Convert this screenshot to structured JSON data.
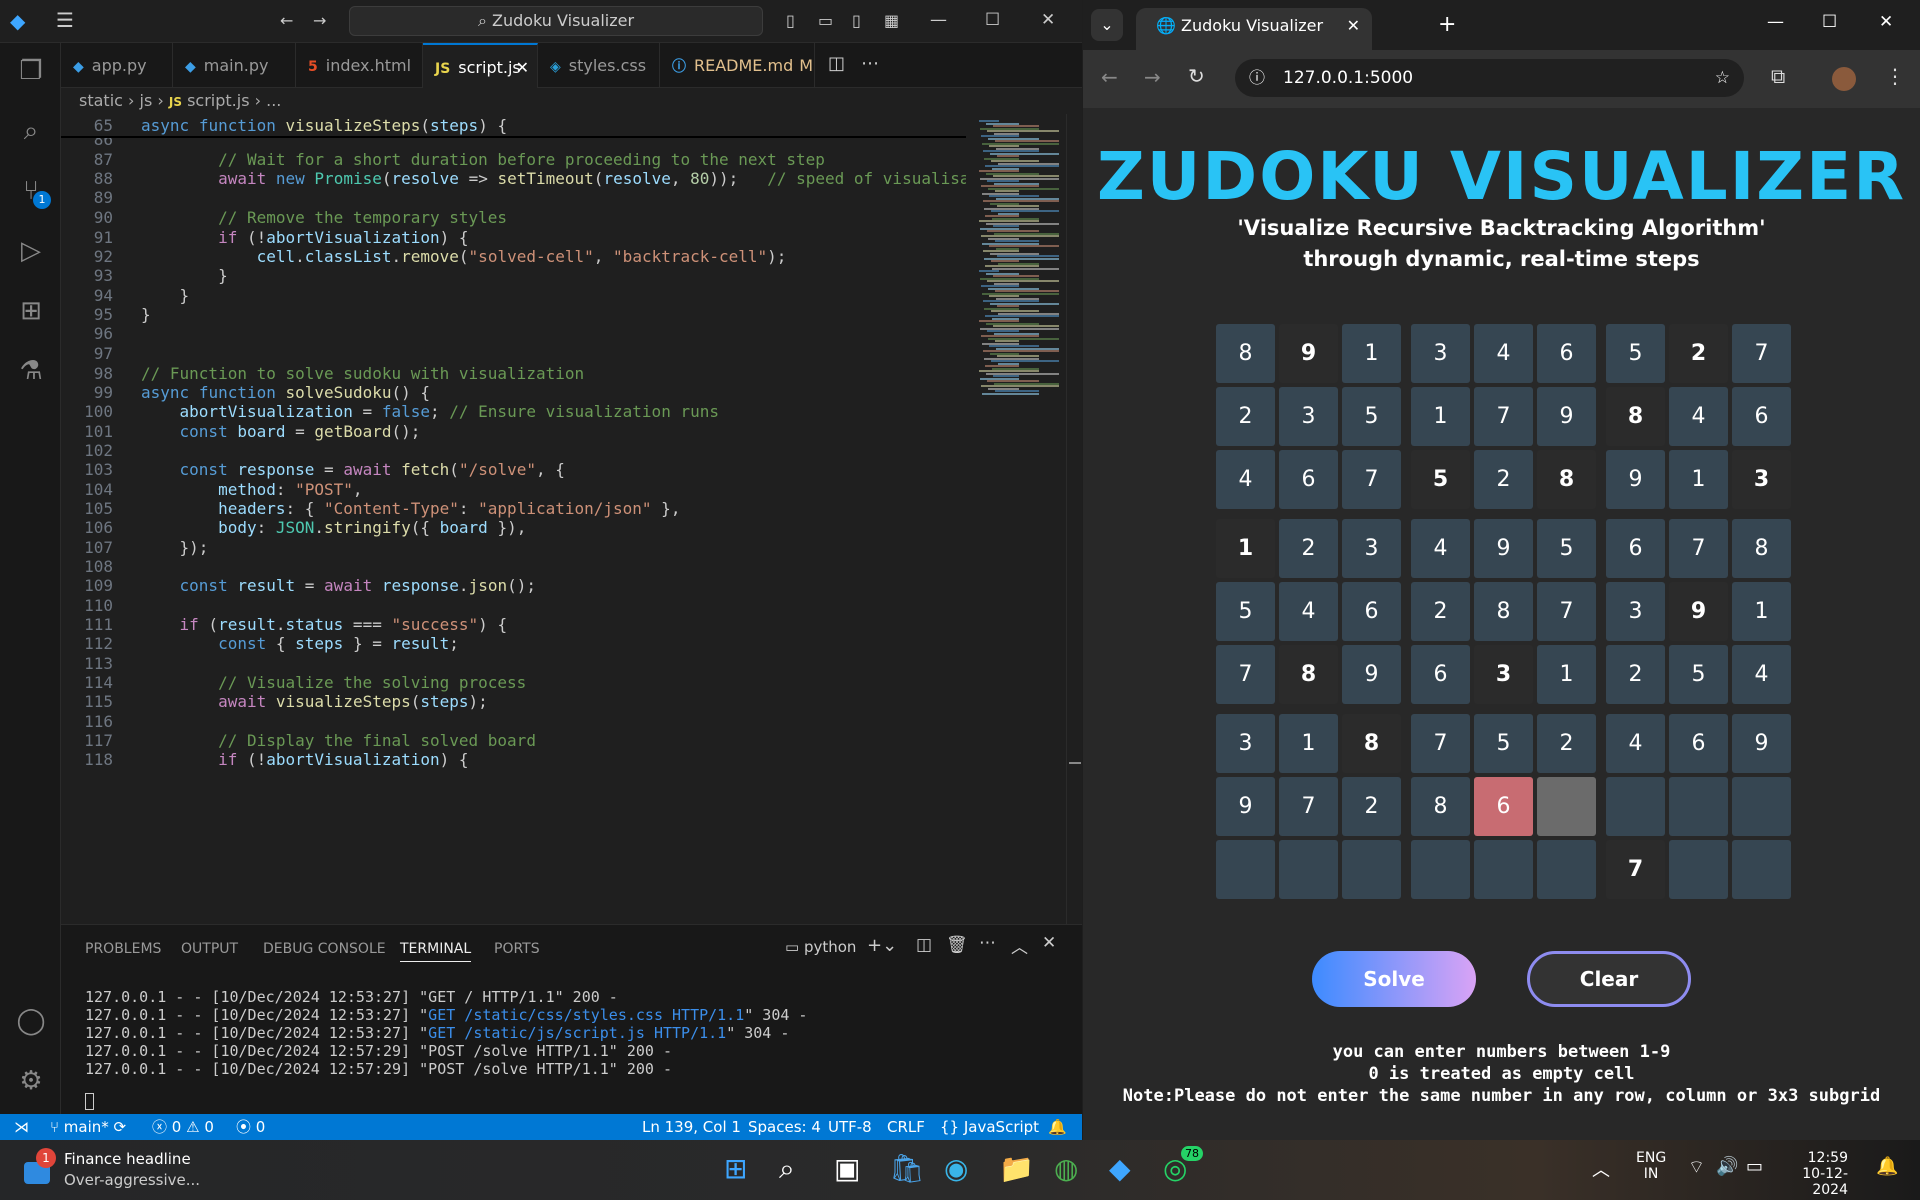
{
  "vscode": {
    "search_label": "Zudoku Visualizer",
    "tabs": [
      {
        "label": "app.py",
        "icon": "python-icon"
      },
      {
        "label": "main.py",
        "icon": "python-icon"
      },
      {
        "label": "index.html",
        "icon": "html-icon"
      },
      {
        "label": "script.js",
        "icon": "javascript-icon",
        "active": true
      },
      {
        "label": "styles.css",
        "icon": "css-icon"
      },
      {
        "label": "README.md",
        "icon": "info-icon",
        "badge": "M"
      }
    ],
    "breadcrumb": [
      "static",
      "js",
      "script.js",
      "..."
    ],
    "code_lines": [
      {
        "n": "65",
        "text": "async function visualizeSteps(steps) {"
      },
      {
        "n": "86",
        "text": ""
      },
      {
        "n": "87",
        "text": "        // Wait for a short duration before proceeding to the next step"
      },
      {
        "n": "88",
        "text": "        await new Promise(resolve => setTimeout(resolve, 80));   // speed of visualisa"
      },
      {
        "n": "89",
        "text": ""
      },
      {
        "n": "90",
        "text": "        // Remove the temporary styles"
      },
      {
        "n": "91",
        "text": "        if (!abortVisualization) {"
      },
      {
        "n": "92",
        "text": "            cell.classList.remove(\"solved-cell\", \"backtrack-cell\");"
      },
      {
        "n": "93",
        "text": "        }"
      },
      {
        "n": "94",
        "text": "    }"
      },
      {
        "n": "95",
        "text": "}"
      },
      {
        "n": "96",
        "text": ""
      },
      {
        "n": "97",
        "text": ""
      },
      {
        "n": "98",
        "text": "// Function to solve sudoku with visualization"
      },
      {
        "n": "99",
        "text": "async function solveSudoku() {"
      },
      {
        "n": "100",
        "text": "    abortVisualization = false; // Ensure visualization runs"
      },
      {
        "n": "101",
        "text": "    const board = getBoard();"
      },
      {
        "n": "102",
        "text": ""
      },
      {
        "n": "103",
        "text": "    const response = await fetch(\"/solve\", {"
      },
      {
        "n": "104",
        "text": "        method: \"POST\","
      },
      {
        "n": "105",
        "text": "        headers: { \"Content-Type\": \"application/json\" },"
      },
      {
        "n": "106",
        "text": "        body: JSON.stringify({ board }),"
      },
      {
        "n": "107",
        "text": "    });"
      },
      {
        "n": "108",
        "text": ""
      },
      {
        "n": "109",
        "text": "    const result = await response.json();"
      },
      {
        "n": "110",
        "text": ""
      },
      {
        "n": "111",
        "text": "    if (result.status === \"success\") {"
      },
      {
        "n": "112",
        "text": "        const { steps } = result;"
      },
      {
        "n": "113",
        "text": ""
      },
      {
        "n": "114",
        "text": "        // Visualize the solving process"
      },
      {
        "n": "115",
        "text": "        await visualizeSteps(steps);"
      },
      {
        "n": "116",
        "text": ""
      },
      {
        "n": "117",
        "text": "        // Display the final solved board"
      },
      {
        "n": "118",
        "text": "        if (!abortVisualization) {"
      }
    ],
    "panel_tabs": [
      "PROBLEMS",
      "OUTPUT",
      "DEBUG CONSOLE",
      "TERMINAL",
      "PORTS"
    ],
    "terminal_name": "python",
    "terminal_lines": [
      {
        "prefix": "127.0.0.1 - - [10/Dec/2024 12:53:27] \"",
        "link": "",
        "req": "GET / HTTP/1.1",
        "suffix": "\" 200 -"
      },
      {
        "prefix": "127.0.0.1 - - [10/Dec/2024 12:53:27] \"",
        "link": "GET /static/css/styles.css HTTP/1.1",
        "req": "",
        "suffix": "\" 304 -"
      },
      {
        "prefix": "127.0.0.1 - - [10/Dec/2024 12:53:27] \"",
        "link": "GET /static/js/script.js HTTP/1.1",
        "req": "",
        "suffix": "\" 304 -"
      },
      {
        "prefix": "127.0.0.1 - - [10/Dec/2024 12:57:29] \"",
        "link": "",
        "req": "POST /solve HTTP/1.1",
        "suffix": "\" 200 -"
      },
      {
        "prefix": "127.0.0.1 - - [10/Dec/2024 12:57:29] \"",
        "link": "",
        "req": "POST /solve HTTP/1.1",
        "suffix": "\" 200 -"
      }
    ],
    "status": {
      "branch": "main*",
      "errors": "0",
      "warnings": "0",
      "ports": "0",
      "position": "Ln 139, Col 1",
      "spaces": "Spaces: 4",
      "encoding": "UTF-8",
      "eol": "CRLF",
      "language": "JavaScript",
      "scm_badge": "1"
    }
  },
  "browser": {
    "tab_title": "Zudoku Visualizer",
    "url": "127.0.0.1:5000",
    "heading": "ZUDOKU VISUALIZER",
    "subtitle_1": "'Visualize Recursive Backtracking Algorithm'",
    "subtitle_2": "through dynamic, real-time steps",
    "board": [
      [
        "8",
        "9",
        "1",
        "3",
        "4",
        "6",
        "5",
        "2",
        "7"
      ],
      [
        "2",
        "3",
        "5",
        "1",
        "7",
        "9",
        "8",
        "4",
        "6"
      ],
      [
        "4",
        "6",
        "7",
        "5",
        "2",
        "8",
        "9",
        "1",
        "3"
      ],
      [
        "1",
        "2",
        "3",
        "4",
        "9",
        "5",
        "6",
        "7",
        "8"
      ],
      [
        "5",
        "4",
        "6",
        "2",
        "8",
        "7",
        "3",
        "9",
        "1"
      ],
      [
        "7",
        "8",
        "9",
        "6",
        "3",
        "1",
        "2",
        "5",
        "4"
      ],
      [
        "3",
        "1",
        "8",
        "7",
        "5",
        "2",
        "4",
        "6",
        "9"
      ],
      [
        "9",
        "7",
        "2",
        "8",
        "6",
        "",
        "",
        "",
        ""
      ],
      [
        "",
        "",
        "",
        "",
        "",
        "",
        "7",
        "",
        ""
      ]
    ],
    "given": [
      [
        0,
        1
      ],
      [
        0,
        7
      ],
      [
        1,
        6
      ],
      [
        2,
        3
      ],
      [
        2,
        5
      ],
      [
        2,
        8
      ],
      [
        3,
        0
      ],
      [
        4,
        7
      ],
      [
        5,
        1
      ],
      [
        5,
        4
      ],
      [
        6,
        2
      ],
      [
        8,
        6
      ]
    ],
    "solved_cell": [
      7,
      4
    ],
    "backtrack_cell": [
      7,
      5
    ],
    "solve_label": "Solve",
    "clear_label": "Clear",
    "note_1": "you can enter numbers between 1-9",
    "note_2": "0 is treated as empty cell",
    "note_3": "Note:Please do not enter the same number in any row, column or 3x3 subgrid"
  },
  "taskbar": {
    "news_title": "Finance headline",
    "news_sub": "Over-aggressive...",
    "news_badge": "1",
    "whatsapp_badge": "78",
    "lang_1": "ENG",
    "lang_2": "IN",
    "time": "12:59",
    "date": "10-12-2024"
  }
}
